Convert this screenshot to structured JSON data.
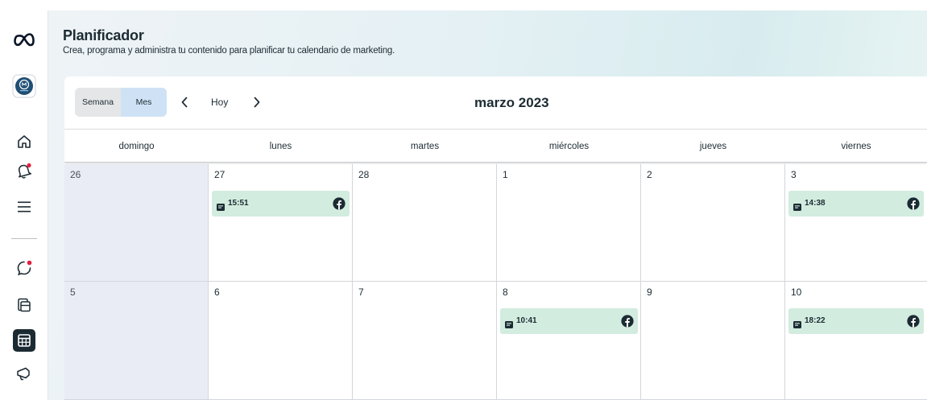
{
  "page": {
    "title": "Planificador",
    "subtitle": "Crea, programa y administra tu contenido para planificar tu calendario de marketing."
  },
  "sidebar": {
    "items": [
      {
        "name": "meta-logo-icon"
      },
      {
        "name": "profile-avatar"
      },
      {
        "name": "home-icon"
      },
      {
        "name": "notifications-icon"
      },
      {
        "name": "menu-icon"
      },
      {
        "name": "messages-icon"
      },
      {
        "name": "content-icon"
      },
      {
        "name": "planner-icon",
        "active": true
      },
      {
        "name": "ads-icon"
      }
    ]
  },
  "toolbar": {
    "week_label": "Semana",
    "month_label": "Mes",
    "today_label": "Hoy",
    "month_title": "marzo 2023"
  },
  "calendar": {
    "weekdays": [
      "domingo",
      "lunes",
      "martes",
      "miércoles",
      "jueves",
      "viernes"
    ],
    "weeks": [
      [
        {
          "day": "26",
          "past": true,
          "posts": []
        },
        {
          "day": "27",
          "past": false,
          "posts": [
            {
              "time": "15:51",
              "network": "facebook"
            }
          ]
        },
        {
          "day": "28",
          "past": false,
          "posts": []
        },
        {
          "day": "1",
          "past": false,
          "posts": []
        },
        {
          "day": "2",
          "past": false,
          "posts": []
        },
        {
          "day": "3",
          "past": false,
          "posts": [
            {
              "time": "14:38",
              "network": "facebook"
            }
          ]
        }
      ],
      [
        {
          "day": "5",
          "past": true,
          "posts": []
        },
        {
          "day": "6",
          "past": false,
          "posts": []
        },
        {
          "day": "7",
          "past": false,
          "posts": []
        },
        {
          "day": "8",
          "past": false,
          "posts": [
            {
              "time": "10:41",
              "network": "facebook"
            }
          ]
        },
        {
          "day": "9",
          "past": false,
          "posts": []
        },
        {
          "day": "10",
          "past": false,
          "posts": [
            {
              "time": "18:22",
              "network": "facebook"
            }
          ]
        }
      ]
    ]
  },
  "colors": {
    "chip_bg": "#d2ecdf",
    "past_day_bg": "#e9ecf5",
    "active_view_bg": "#cfe2f5",
    "facebook_blue": "#1877f2",
    "notification_dot": "#e41e3f"
  }
}
